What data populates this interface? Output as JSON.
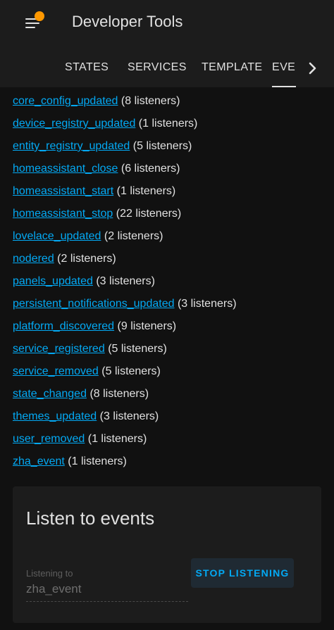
{
  "header": {
    "title": "Developer Tools",
    "menu_icon": "hamburger-menu-icon",
    "notification_color": "#ff9800"
  },
  "tabs": [
    {
      "label": "STATES",
      "active": false
    },
    {
      "label": "SERVICES",
      "active": false
    },
    {
      "label": "TEMPLATE",
      "active": false
    },
    {
      "label": "EVENTS",
      "active": true
    }
  ],
  "tab_scroll_icon": "chevron-right-icon",
  "events": [
    {
      "name": "core_config_updated",
      "count": "(8 listeners)"
    },
    {
      "name": "device_registry_updated",
      "count": "(1 listeners)"
    },
    {
      "name": "entity_registry_updated",
      "count": "(5 listeners)"
    },
    {
      "name": "homeassistant_close",
      "count": "(6 listeners)"
    },
    {
      "name": "homeassistant_start",
      "count": "(1 listeners)"
    },
    {
      "name": "homeassistant_stop",
      "count": "(22 listeners)"
    },
    {
      "name": "lovelace_updated",
      "count": "(2 listeners)"
    },
    {
      "name": "nodered",
      "count": "(2 listeners)"
    },
    {
      "name": "panels_updated",
      "count": "(3 listeners)"
    },
    {
      "name": "persistent_notifications_updated",
      "count": "(3 listeners)"
    },
    {
      "name": "platform_discovered",
      "count": "(9 listeners)"
    },
    {
      "name": "service_registered",
      "count": "(5 listeners)"
    },
    {
      "name": "service_removed",
      "count": "(5 listeners)"
    },
    {
      "name": "state_changed",
      "count": "(8 listeners)"
    },
    {
      "name": "themes_updated",
      "count": "(3 listeners)"
    },
    {
      "name": "user_removed",
      "count": "(1 listeners)"
    },
    {
      "name": "zha_event",
      "count": "(1 listeners)"
    }
  ],
  "listen": {
    "title": "Listen to events",
    "field_label": "Listening to",
    "field_value": "zha_event",
    "stop_label": "STOP LISTENING"
  },
  "colors": {
    "link": "#03a9f4",
    "background": "#111111",
    "surface": "#1c1c1c"
  }
}
